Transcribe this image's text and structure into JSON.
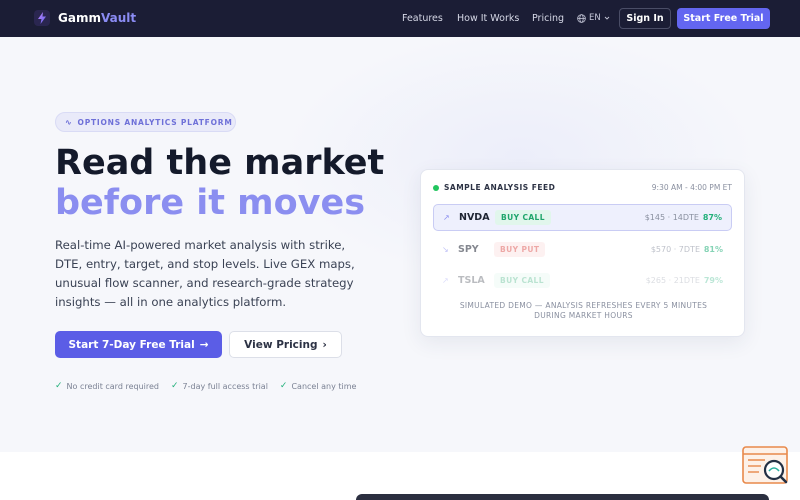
{
  "nav": {
    "brand_part1": "Gamm",
    "brand_part2": "Vault",
    "links": [
      "Features",
      "How It Works",
      "Pricing"
    ],
    "language": "EN",
    "sign_in": "Sign In",
    "trial": "Start Free Trial"
  },
  "hero": {
    "badge": "OPTIONS ANALYTICS PLATFORM",
    "headline_line1": "Read the market",
    "headline_line2": "before it moves",
    "lead": "Real-time AI-powered market analysis with strike, DTE, entry, target, and stop levels. Live GEX maps, unusual flow scanner, and research-grade strategy insights — all in one analytics platform.",
    "cta_primary": "Start 7-Day Free Trial",
    "cta_secondary": "View Pricing",
    "checks": [
      "No credit card required",
      "7-day full access trial",
      "Cancel any time"
    ]
  },
  "feed": {
    "title": "SAMPLE ANALYSIS FEED",
    "hours": "9:30 AM - 4:00 PM ET",
    "rows": [
      {
        "symbol": "NVDA",
        "signal": "BUY CALL",
        "meta": "$145 · 14DTE",
        "pct": "87%"
      },
      {
        "symbol": "SPY",
        "signal": "BUY PUT",
        "meta": "$570 · 7DTE",
        "pct": "81%"
      },
      {
        "symbol": "TSLA",
        "signal": "BUY CALL",
        "meta": "$265 · 21DTE",
        "pct": "79%"
      }
    ],
    "note": "SIMULATED DEMO — ANALYSIS REFRESHES EVERY 5 MINUTES DURING MARKET HOURS"
  },
  "colors": {
    "nav_bg": "#1b1d35",
    "accent": "#6366f1",
    "headline_accent": "#8b8ef0",
    "positive": "#22b07a",
    "negative": "#e0625f"
  }
}
